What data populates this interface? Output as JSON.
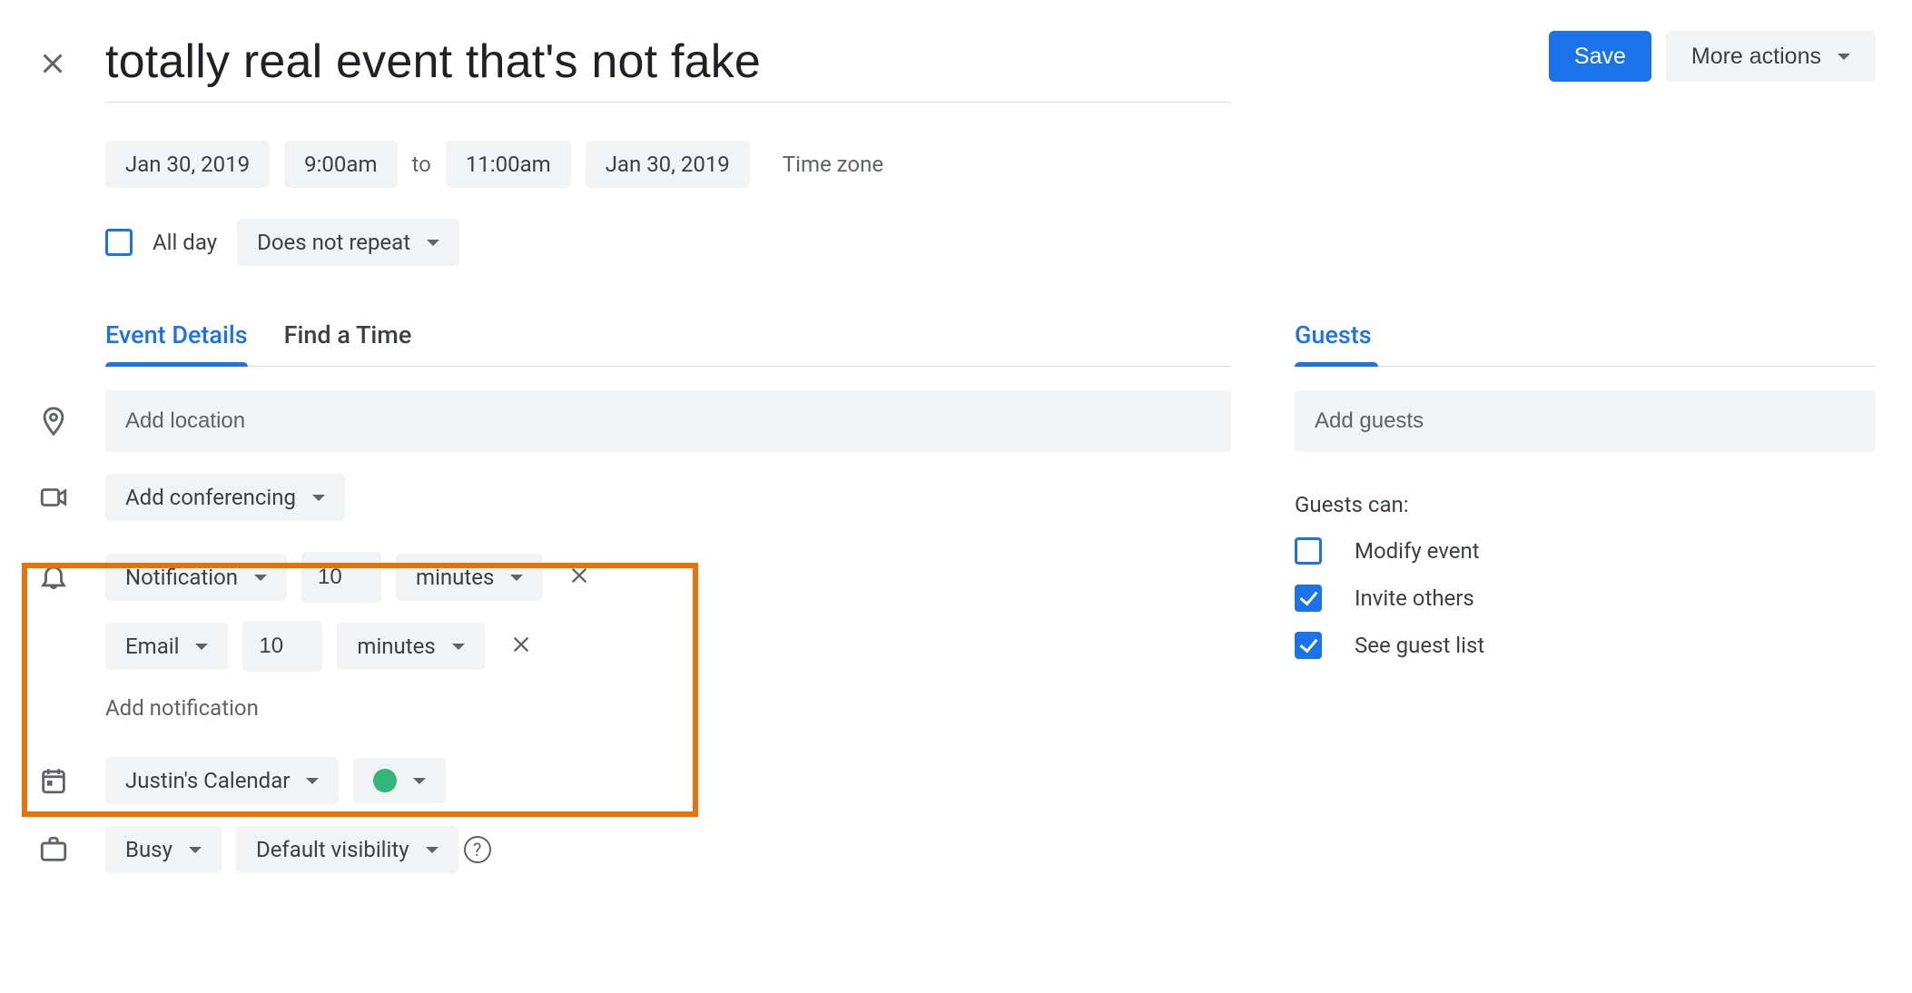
{
  "title": "totally real event that's not fake",
  "save_label": "Save",
  "more_actions_label": "More actions",
  "date_start": "Jan 30, 2019",
  "time_start": "9:00am",
  "to_label": "to",
  "time_end": "11:00am",
  "date_end": "Jan 30, 2019",
  "timezone_label": "Time zone",
  "all_day_label": "All day",
  "all_day_checked": false,
  "repeat_label": "Does not repeat",
  "tabs": {
    "details": "Event Details",
    "find_time": "Find a Time"
  },
  "location_placeholder": "Add location",
  "conferencing_label": "Add conferencing",
  "notifications": [
    {
      "type": "Notification",
      "value": "10",
      "unit": "minutes"
    },
    {
      "type": "Email",
      "value": "10",
      "unit": "minutes"
    }
  ],
  "add_notification_label": "Add notification",
  "calendar_label": "Justin's Calendar",
  "calendar_color": "#33b679",
  "busy_label": "Busy",
  "visibility_label": "Default visibility",
  "guests_tab": "Guests",
  "guests_placeholder": "Add guests",
  "guests_can_label": "Guests can:",
  "perms": {
    "modify": {
      "label": "Modify event",
      "checked": false
    },
    "invite": {
      "label": "Invite others",
      "checked": true
    },
    "see": {
      "label": "See guest list",
      "checked": true
    }
  }
}
